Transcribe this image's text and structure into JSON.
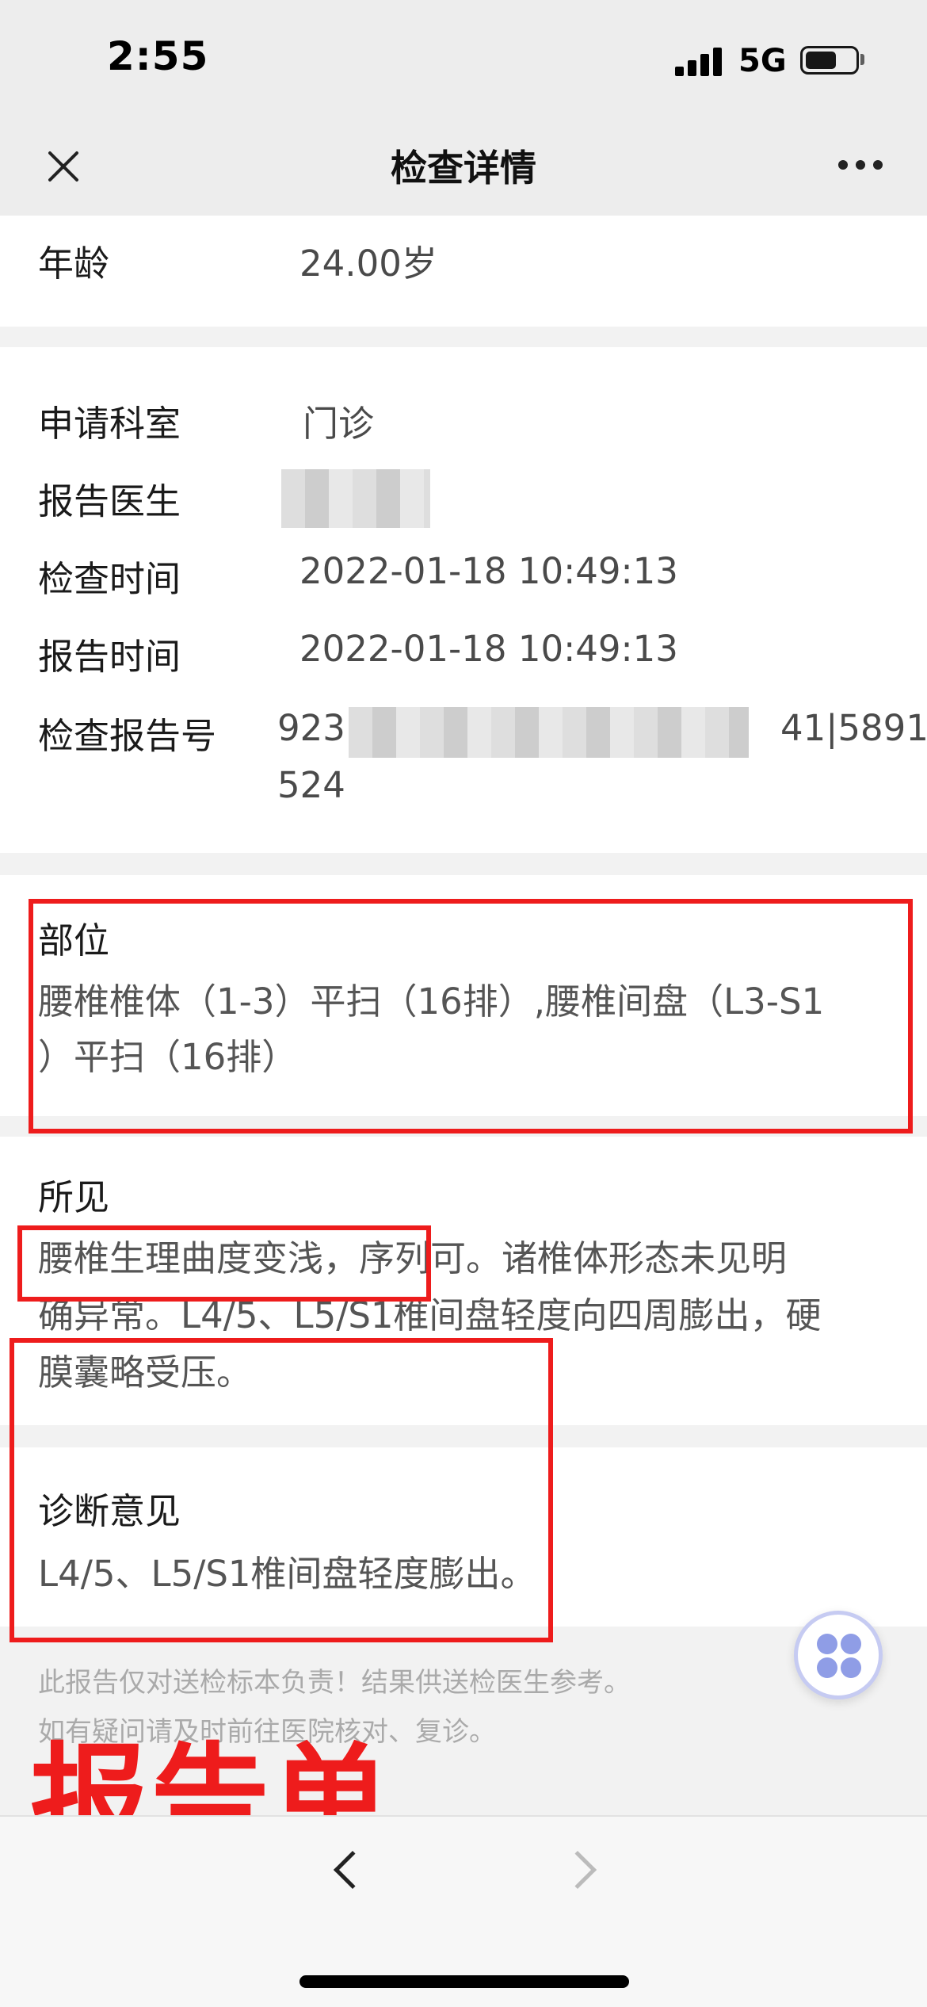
{
  "status_bar": {
    "time": "2:55",
    "network": "5G"
  },
  "nav": {
    "title": "检查详情"
  },
  "patient": {
    "age_label": "年龄",
    "age_value": "24.00岁"
  },
  "info": {
    "department_label": "申请科室",
    "department_value": "门诊",
    "doctor_label": "报告医生",
    "exam_time_label": "检查时间",
    "exam_time_value": "2022-01-18 10:49:13",
    "report_time_label": "报告时间",
    "report_time_value": "2022-01-18 10:49:13",
    "report_no_label": "检查报告号",
    "report_no_prefix": "923",
    "report_no_suffix": "41|5891",
    "report_no_line2": "524"
  },
  "site": {
    "title": "部位",
    "line1": "腰椎椎体（1-3）平扫（16排）,腰椎间盘（L3-S1",
    "line2": "）平扫（16排）"
  },
  "findings": {
    "title": "所见",
    "line1": "腰椎生理曲度变浅，序列可。诸椎体形态未见明",
    "line2": "确异常。L4/5、L5/S1椎间盘轻度向四周膨出，硬",
    "line3": "膜囊略受压。"
  },
  "diagnosis": {
    "title": "诊断意见",
    "text": "L4/5、L5/S1椎间盘轻度膨出。"
  },
  "footer": {
    "disclaimer_line1": "此报告仅对送检标本负责！结果供送检医生参考。",
    "disclaimer_line2": "如有疑问请及时前往医院核对、复诊。"
  },
  "stamp": "报告单",
  "icons": [
    "close-icon",
    "more-icon",
    "float-app-icon",
    "back-icon",
    "forward-icon"
  ],
  "colors": {
    "annotation_red": "#ee1c1c",
    "float_accent": "#8f9de6"
  }
}
